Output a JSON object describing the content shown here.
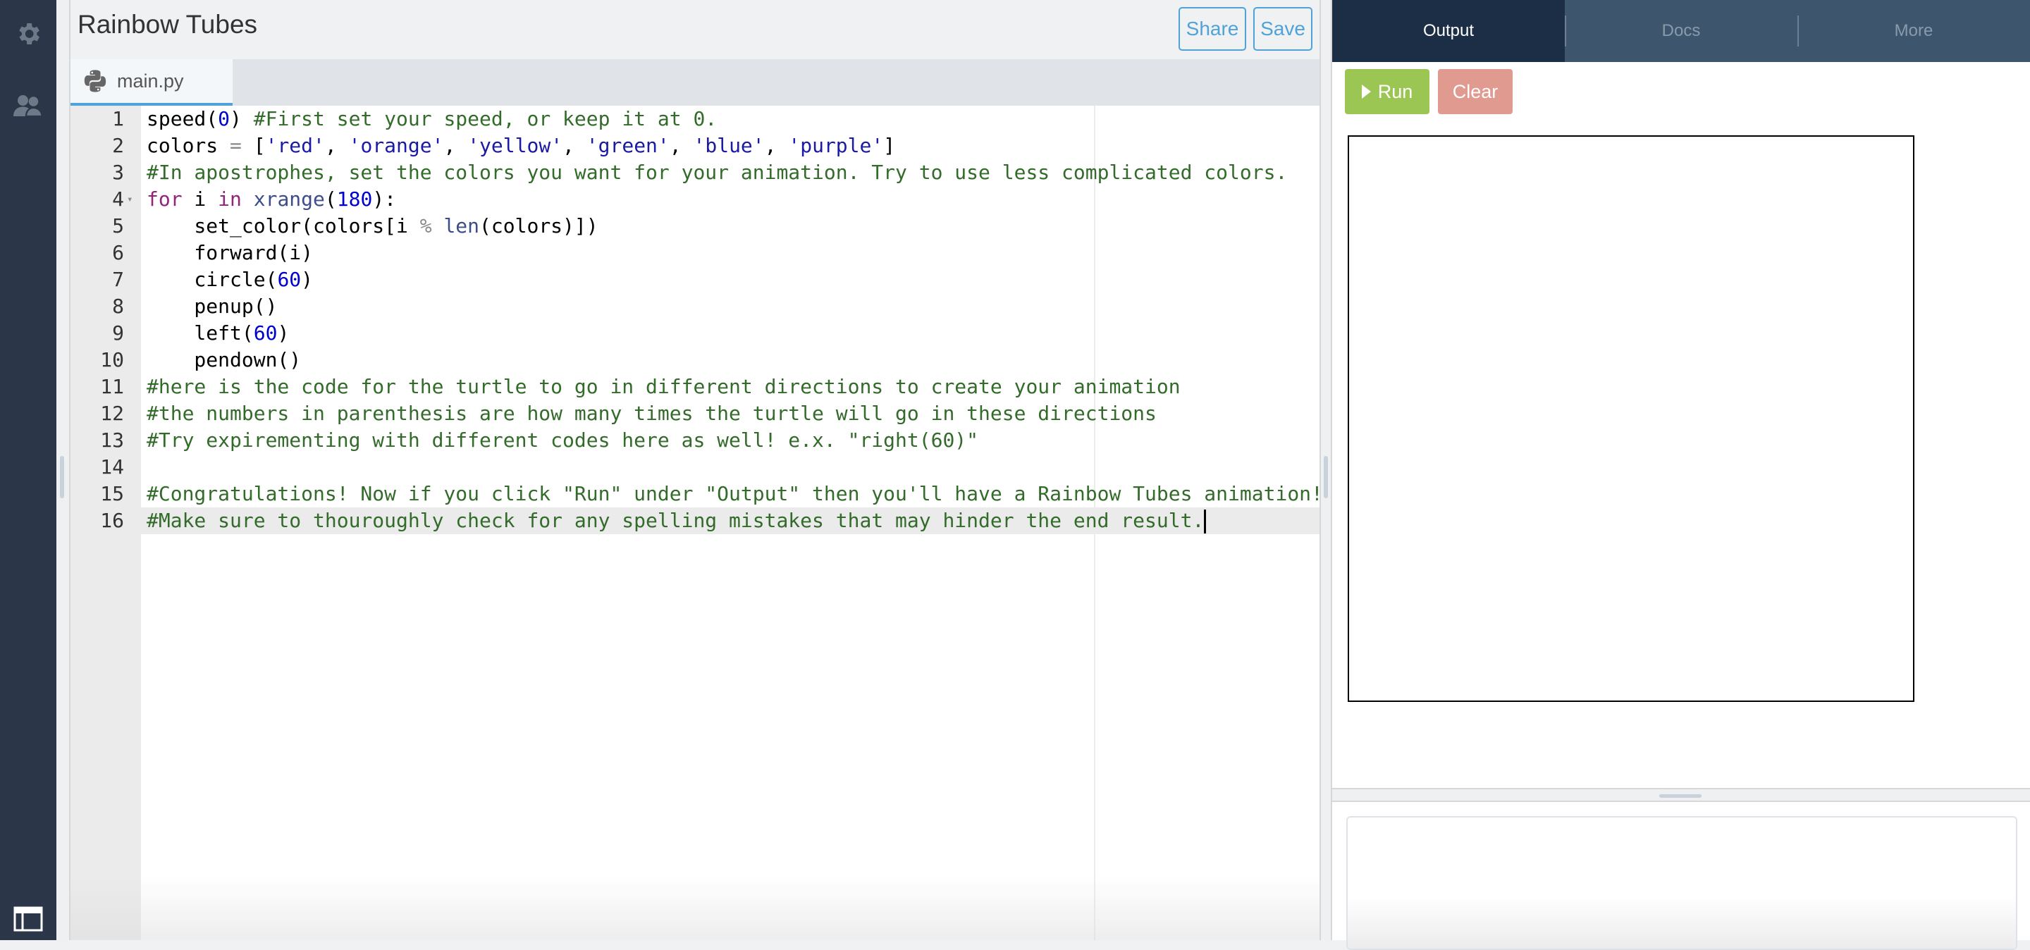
{
  "rail": {
    "icons": [
      "gear-icon",
      "users-icon",
      "layout-icon"
    ]
  },
  "editor": {
    "title": "Rainbow Tubes",
    "share_label": "Share",
    "save_label": "Save",
    "file_tab": {
      "icon": "python-icon",
      "label": "main.py"
    },
    "active_line": 16,
    "lines": [
      {
        "n": "1",
        "tokens": [
          [
            "",
            "speed("
          ],
          [
            "nm",
            "0"
          ],
          [
            "",
            ") "
          ],
          [
            "cm",
            "#First set your speed, or keep it at 0."
          ]
        ]
      },
      {
        "n": "2",
        "tokens": [
          [
            "",
            "colors "
          ],
          [
            "op",
            "="
          ],
          [
            "",
            " ["
          ],
          [
            "st",
            "'red'"
          ],
          [
            "",
            ", "
          ],
          [
            "st",
            "'orange'"
          ],
          [
            "",
            ", "
          ],
          [
            "st",
            "'yellow'"
          ],
          [
            "",
            ", "
          ],
          [
            "st",
            "'green'"
          ],
          [
            "",
            ", "
          ],
          [
            "st",
            "'blue'"
          ],
          [
            "",
            ", "
          ],
          [
            "st",
            "'purple'"
          ],
          [
            "",
            "]"
          ]
        ]
      },
      {
        "n": "3",
        "tokens": [
          [
            "cm",
            "#In apostrophes, set the colors you want for your animation. Try to use less complicated colors."
          ]
        ]
      },
      {
        "n": "4",
        "fold": true,
        "tokens": [
          [
            "kw",
            "for"
          ],
          [
            "",
            " i "
          ],
          [
            "kw",
            "in"
          ],
          [
            "",
            " "
          ],
          [
            "bi",
            "xrange"
          ],
          [
            "",
            "("
          ],
          [
            "nm",
            "180"
          ],
          [
            "",
            "):"
          ]
        ]
      },
      {
        "n": "5",
        "tokens": [
          [
            "",
            "    set_color(colors[i "
          ],
          [
            "op",
            "%"
          ],
          [
            "",
            " "
          ],
          [
            "bi",
            "len"
          ],
          [
            "",
            "(colors)])"
          ]
        ]
      },
      {
        "n": "6",
        "tokens": [
          [
            "",
            "    forward(i)"
          ]
        ]
      },
      {
        "n": "7",
        "tokens": [
          [
            "",
            "    circle("
          ],
          [
            "nm",
            "60"
          ],
          [
            "",
            ")"
          ]
        ]
      },
      {
        "n": "8",
        "tokens": [
          [
            "",
            "    penup()"
          ]
        ]
      },
      {
        "n": "9",
        "tokens": [
          [
            "",
            "    left("
          ],
          [
            "nm",
            "60"
          ],
          [
            "",
            ")"
          ]
        ]
      },
      {
        "n": "10",
        "tokens": [
          [
            "",
            "    pendown()"
          ]
        ]
      },
      {
        "n": "11",
        "tokens": [
          [
            "cm",
            "#here is the code for the turtle to go in different directions to create your animation"
          ]
        ]
      },
      {
        "n": "12",
        "tokens": [
          [
            "cm",
            "#the numbers in parenthesis are how many times the turtle will go in these directions"
          ]
        ]
      },
      {
        "n": "13",
        "tokens": [
          [
            "cm",
            "#Try expirementing with different codes here as well! e.x. \"right(60)\""
          ]
        ]
      },
      {
        "n": "14",
        "tokens": []
      },
      {
        "n": "15",
        "tokens": [
          [
            "cm",
            "#Congratulations! Now if you click \"Run\" under \"Output\" then you'll have a Rainbow Tubes animation!"
          ]
        ]
      },
      {
        "n": "16",
        "tokens": [
          [
            "cm",
            "#Make sure to thouroughly check for any spelling mistakes that may hinder the end result."
          ]
        ]
      }
    ]
  },
  "output": {
    "tabs": [
      {
        "label": "Output",
        "active": true
      },
      {
        "label": "Docs",
        "active": false
      },
      {
        "label": "More",
        "active": false
      }
    ],
    "run_label": "Run",
    "clear_label": "Clear"
  },
  "colors": {
    "accent": "#4fa3d8",
    "run": "#9cc654",
    "clear": "#e19a8f",
    "rail": "#2b3749",
    "active_tab": "#1b2e45",
    "tab_bar": "#3d566e",
    "comment": "#336b2a",
    "string": "#1a1aa6",
    "number": "#0000cd",
    "keyword": "#93237b"
  }
}
